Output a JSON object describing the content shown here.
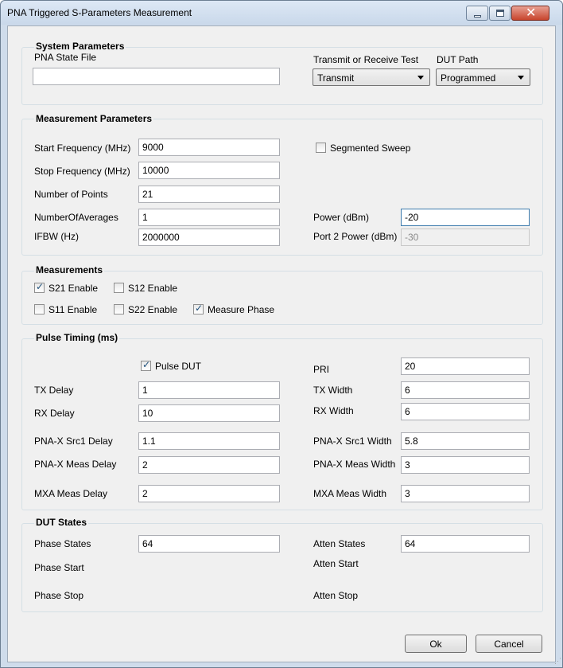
{
  "window": {
    "title": "PNA Triggered S-Parameters Measurement"
  },
  "system": {
    "title": "System Parameters",
    "state_file_label": "PNA State File",
    "state_file_value": "",
    "test_label": "Transmit or Receive Test",
    "test_value": "Transmit",
    "dut_path_label": "DUT Path",
    "dut_path_value": "Programmed"
  },
  "measurement": {
    "title": "Measurement Parameters",
    "start_label": "Start Frequency (MHz)",
    "start_value": "9000",
    "stop_label": "Stop Frequency (MHz)",
    "stop_value": "10000",
    "points_label": "Number of Points",
    "points_value": "21",
    "averages_label": "NumberOfAverages",
    "averages_value": "1",
    "ifbw_label": "IFBW (Hz)",
    "ifbw_value": "2000000",
    "segmented_label": "Segmented Sweep",
    "segmented_checked": false,
    "power_label": "Power (dBm)",
    "power_value": "-20",
    "port2_label": "Port 2 Power (dBm)",
    "port2_value": "-30"
  },
  "measurements": {
    "title": "Measurements",
    "s21_label": "S21 Enable",
    "s21_checked": true,
    "s12_label": "S12 Enable",
    "s12_checked": false,
    "s11_label": "S11 Enable",
    "s11_checked": false,
    "s22_label": "S22 Enable",
    "s22_checked": false,
    "phase_label": "Measure Phase",
    "phase_checked": true
  },
  "pulse": {
    "title": "Pulse Timing (ms)",
    "pulse_dut_label": "Pulse DUT",
    "pulse_dut_checked": true,
    "pri_label": "PRI",
    "pri_value": "20",
    "tx_delay_label": "TX Delay",
    "tx_delay_value": "1",
    "tx_width_label": "TX Width",
    "tx_width_value": "6",
    "rx_delay_label": "RX Delay",
    "rx_delay_value": "10",
    "rx_width_label": "RX Width",
    "rx_width_value": "6",
    "src1_delay_label": "PNA-X Src1 Delay",
    "src1_delay_value": "1.1",
    "src1_width_label": "PNA-X Src1 Width",
    "src1_width_value": "5.8",
    "meas_delay_label": "PNA-X Meas Delay",
    "meas_delay_value": "2",
    "meas_width_label": "PNA-X Meas Width",
    "meas_width_value": "3",
    "mxa_delay_label": "MXA Meas Delay",
    "mxa_delay_value": "2",
    "mxa_width_label": "MXA Meas Width",
    "mxa_width_value": "3"
  },
  "dut": {
    "title": "DUT States",
    "phase_states_label": "Phase States",
    "phase_states_value": "64",
    "atten_states_label": "Atten States",
    "atten_states_value": "64",
    "phase_start_label": "Phase Start",
    "atten_start_label": "Atten Start",
    "phase_stop_label": "Phase Stop",
    "atten_stop_label": "Atten Stop"
  },
  "buttons": {
    "ok": "Ok",
    "cancel": "Cancel"
  },
  "icons": {
    "minimize": "minimize-icon",
    "maximize": "maximize-icon",
    "close": "close-icon",
    "checkmark": "checkmark-icon"
  },
  "colors": {
    "titlebar": "#cfdceb",
    "close_button": "#c7442c",
    "client": "#f0f0f0",
    "focus_border": "#3d7bad"
  }
}
